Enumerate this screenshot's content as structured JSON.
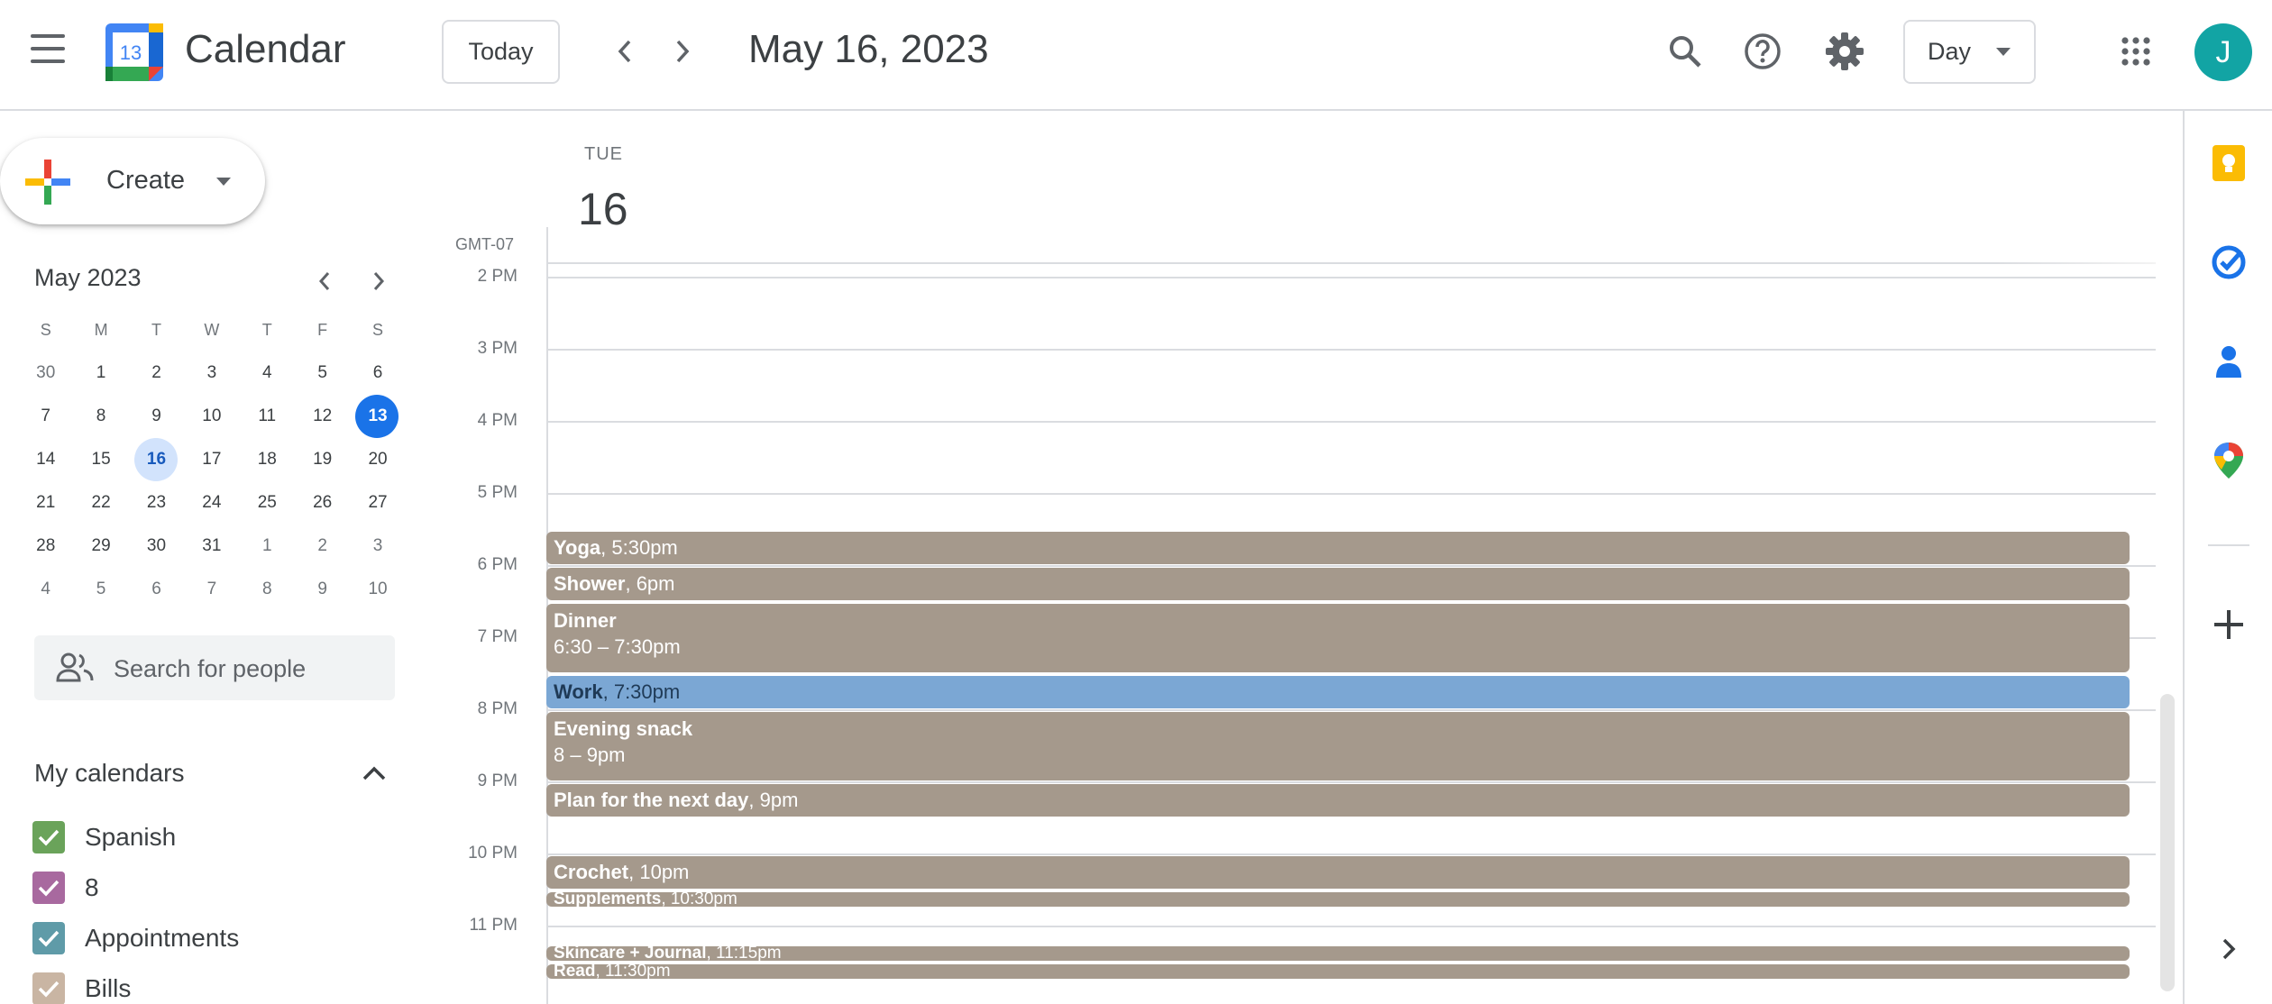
{
  "header": {
    "app_title": "Calendar",
    "logo_day": "13",
    "today_label": "Today",
    "current_date": "May 16, 2023",
    "view_label": "Day",
    "avatar_initial": "J"
  },
  "sidebar": {
    "create_label": "Create",
    "mini_calendar": {
      "month_label": "May 2023",
      "weekdays": [
        "S",
        "M",
        "T",
        "W",
        "T",
        "F",
        "S"
      ],
      "weeks": [
        [
          "30",
          "1",
          "2",
          "3",
          "4",
          "5",
          "6"
        ],
        [
          "7",
          "8",
          "9",
          "10",
          "11",
          "12",
          "13"
        ],
        [
          "14",
          "15",
          "16",
          "17",
          "18",
          "19",
          "20"
        ],
        [
          "21",
          "22",
          "23",
          "24",
          "25",
          "26",
          "27"
        ],
        [
          "28",
          "29",
          "30",
          "31",
          "1",
          "2",
          "3"
        ],
        [
          "4",
          "5",
          "6",
          "7",
          "8",
          "9",
          "10"
        ]
      ],
      "selected": "13",
      "today": "16"
    },
    "people_search_placeholder": "Search for people",
    "my_calendars_title": "My calendars",
    "calendars": [
      {
        "name": "Spanish",
        "color": "#6aa35a"
      },
      {
        "name": "8",
        "color": "#a8699f"
      },
      {
        "name": "Appointments",
        "color": "#5f9ba8"
      },
      {
        "name": "Bills",
        "color": "#c9b5a3"
      }
    ]
  },
  "day_view": {
    "weekday": "TUE",
    "day_number": "16",
    "timezone": "GMT-07",
    "hours": [
      "2 PM",
      "3 PM",
      "4 PM",
      "5 PM",
      "6 PM",
      "7 PM",
      "8 PM",
      "9 PM",
      "10 PM",
      "11 PM"
    ],
    "events": [
      {
        "title": "Yoga",
        "time": ", 5:30pm",
        "start": 17.5,
        "end": 18.0,
        "layout": "inline",
        "color": "#a5998c"
      },
      {
        "title": "Shower",
        "time": ", 6pm",
        "start": 18.0,
        "end": 18.5,
        "layout": "inline",
        "color": "#a5998c"
      },
      {
        "title": "Dinner",
        "time": "6:30 – 7:30pm",
        "start": 18.5,
        "end": 19.5,
        "layout": "stacked",
        "color": "#a5998c"
      },
      {
        "title": "Work",
        "time": ", 7:30pm",
        "start": 19.5,
        "end": 20.0,
        "layout": "inline",
        "color": "#7ba7d4",
        "dark_text": true
      },
      {
        "title": "Evening snack",
        "time": "8 – 9pm",
        "start": 20.0,
        "end": 21.0,
        "layout": "stacked",
        "color": "#a5998c"
      },
      {
        "title": "Plan for the next day",
        "time": ", 9pm",
        "start": 21.0,
        "end": 21.5,
        "layout": "inline",
        "color": "#a5998c"
      },
      {
        "title": "Crochet",
        "time": ", 10pm",
        "start": 22.0,
        "end": 22.5,
        "layout": "inline",
        "color": "#a5998c"
      },
      {
        "title": "Supplements",
        "time": ", 10:30pm",
        "start": 22.5,
        "end": 22.75,
        "layout": "small",
        "color": "#a5998c"
      },
      {
        "title": "Skincare + Journal",
        "time": ", 11:15pm",
        "start": 23.25,
        "end": 23.5,
        "layout": "small",
        "color": "#a5998c"
      },
      {
        "title": "Read",
        "time": ", 11:30pm",
        "start": 23.5,
        "end": 23.75,
        "layout": "small",
        "color": "#a5998c"
      }
    ]
  },
  "side_panel": {
    "icons": [
      "keep-icon",
      "tasks-icon",
      "contacts-icon",
      "maps-icon",
      "add-icon",
      "expand-icon"
    ]
  }
}
